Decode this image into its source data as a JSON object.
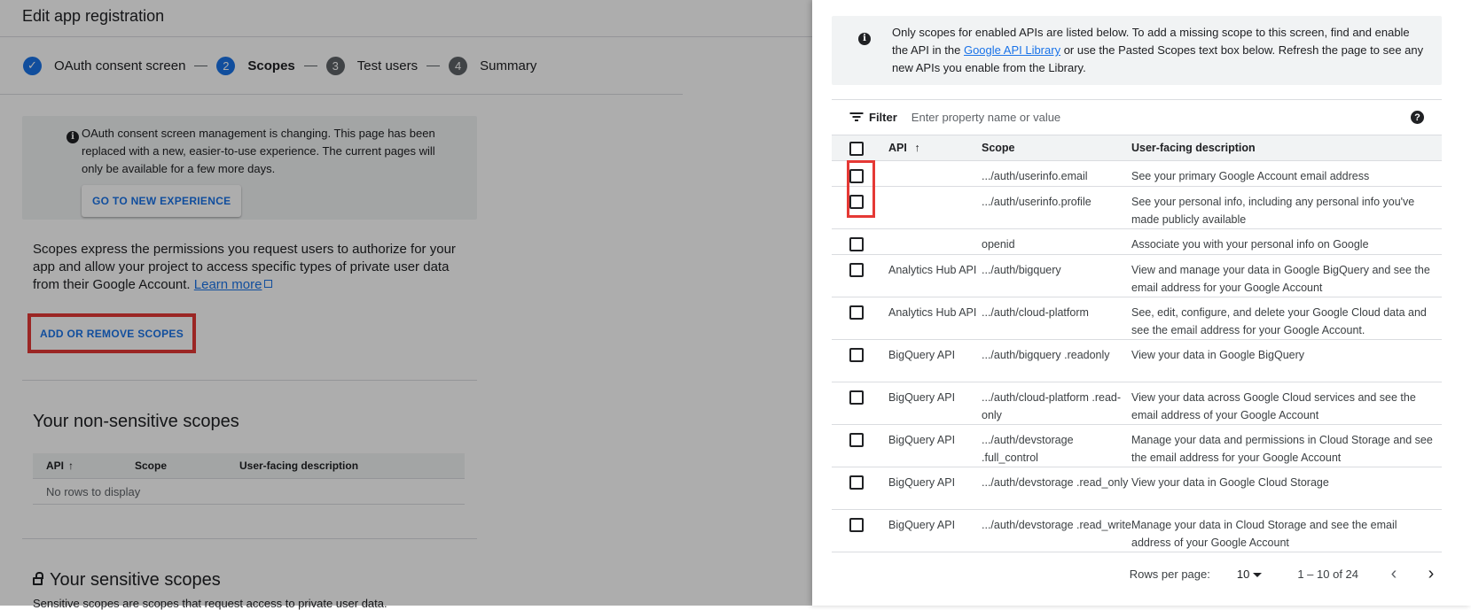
{
  "page": {
    "title": "Edit app registration",
    "steps": [
      {
        "num": "✓",
        "label": "OAuth consent screen",
        "state": "done"
      },
      {
        "num": "2",
        "label": "Scopes",
        "state": "current"
      },
      {
        "num": "3",
        "label": "Test users",
        "state": "todo"
      },
      {
        "num": "4",
        "label": "Summary",
        "state": "todo"
      }
    ],
    "notice": {
      "text": "OAuth consent screen management is changing. This page has been replaced with a new, easier-to-use experience. The current pages will only be available for a few more days.",
      "button": "GO TO NEW EXPERIENCE"
    },
    "scopes_description": "Scopes express the permissions you request users to authorize for your app and allow your project to access specific types of private user data from their Google Account.",
    "learn_more": "Learn more",
    "add_remove_button": "ADD OR REMOVE SCOPES",
    "non_sensitive_title": "Your non-sensitive scopes",
    "mini_table": {
      "col_api": "API",
      "col_scope": "Scope",
      "col_desc": "User-facing description",
      "empty": "No rows to display"
    },
    "sensitive_title": "Your sensitive scopes",
    "sensitive_cutoff": "Sensitive scopes are scopes that request access to private user data."
  },
  "panel": {
    "info_pre": "Only scopes for enabled APIs are listed below. To add a missing scope to this screen, find and enable the API in the ",
    "info_link": "Google API Library",
    "info_post": " or use the Pasted Scopes text box below. Refresh the page to see any new APIs you enable from the Library.",
    "filter_label": "Filter",
    "filter_placeholder": "Enter property name or value",
    "columns": {
      "api": "API",
      "scope": "Scope",
      "desc": "User-facing description"
    },
    "rows": [
      {
        "api": "",
        "scope": ".../auth/userinfo.email",
        "desc": "See your primary Google Account email address"
      },
      {
        "api": "",
        "scope": ".../auth/userinfo.profile",
        "desc": "See your personal info, including any personal info you've made publicly available"
      },
      {
        "api": "",
        "scope": "openid",
        "desc": "Associate you with your personal info on Google"
      },
      {
        "api": "Analytics Hub API",
        "scope": ".../auth/bigquery",
        "desc": "View and manage your data in Google BigQuery and see the email address for your Google Account"
      },
      {
        "api": "Analytics Hub API",
        "scope": ".../auth/cloud-platform",
        "desc": "See, edit, configure, and delete your Google Cloud data and see the email address for your Google Account."
      },
      {
        "api": "BigQuery API",
        "scope": ".../auth/bigquery .readonly",
        "desc": "View your data in Google BigQuery"
      },
      {
        "api": "BigQuery API",
        "scope": ".../auth/cloud-platform .read-only",
        "desc": "View your data across Google Cloud services and see the email address of your Google Account"
      },
      {
        "api": "BigQuery API",
        "scope": ".../auth/devstorage .full_control",
        "desc": "Manage your data and permissions in Cloud Storage and see the email address for your Google Account"
      },
      {
        "api": "BigQuery API",
        "scope": ".../auth/devstorage .read_only",
        "desc": "View your data in Google Cloud Storage"
      },
      {
        "api": "BigQuery API",
        "scope": ".../auth/devstorage .read_write",
        "desc": "Manage your data in Cloud Storage and see the email address of your Google Account"
      }
    ],
    "pager": {
      "rows_per_page_label": "Rows per page:",
      "rows_per_page": "10",
      "range": "1 – 10 of 24"
    }
  }
}
